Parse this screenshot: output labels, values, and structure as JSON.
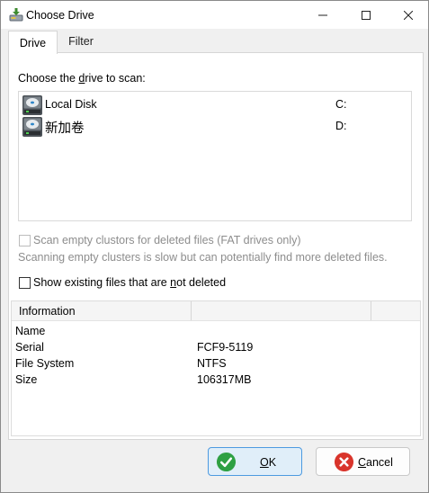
{
  "window": {
    "title": "Choose Drive"
  },
  "tabs": [
    {
      "label": "Drive",
      "active": true
    },
    {
      "label": "Filter",
      "active": false
    }
  ],
  "drive_section": {
    "label_pre": "Choose the ",
    "label_accel": "d",
    "label_post": "rive to scan:",
    "drives": [
      {
        "name": "Local Disk",
        "letter": "C:",
        "icon": "hard-drive-icon"
      },
      {
        "name": "新加卷",
        "letter": "D:",
        "icon": "hard-drive-icon"
      }
    ]
  },
  "options": {
    "scan_empty_clusters": {
      "label": "Scan empty clustors for deleted files (FAT drives only)",
      "checked": false,
      "enabled": false
    },
    "scan_note": "Scanning empty clusters is slow but can potentially find more deleted files.",
    "show_existing": {
      "label_pre": "Show existing files that are ",
      "label_accel": "n",
      "label_post": "ot deleted",
      "checked": false
    }
  },
  "info_panel": {
    "header": "Information",
    "rows": [
      {
        "key": "Name",
        "value": ""
      },
      {
        "key": "Serial",
        "value": "FCF9-5119"
      },
      {
        "key": "File System",
        "value": "NTFS"
      },
      {
        "key": "Size",
        "value": "106317MB"
      }
    ]
  },
  "buttons": {
    "ok": {
      "accel": "O",
      "rest": "K",
      "icon": "check-circle-icon"
    },
    "cancel": {
      "accel": "C",
      "rest": "ancel",
      "icon": "x-circle-icon"
    }
  },
  "colors": {
    "ok_icon": "#2ea043",
    "cancel_icon": "#d9342b",
    "ok_border": "#4d9ae0"
  }
}
